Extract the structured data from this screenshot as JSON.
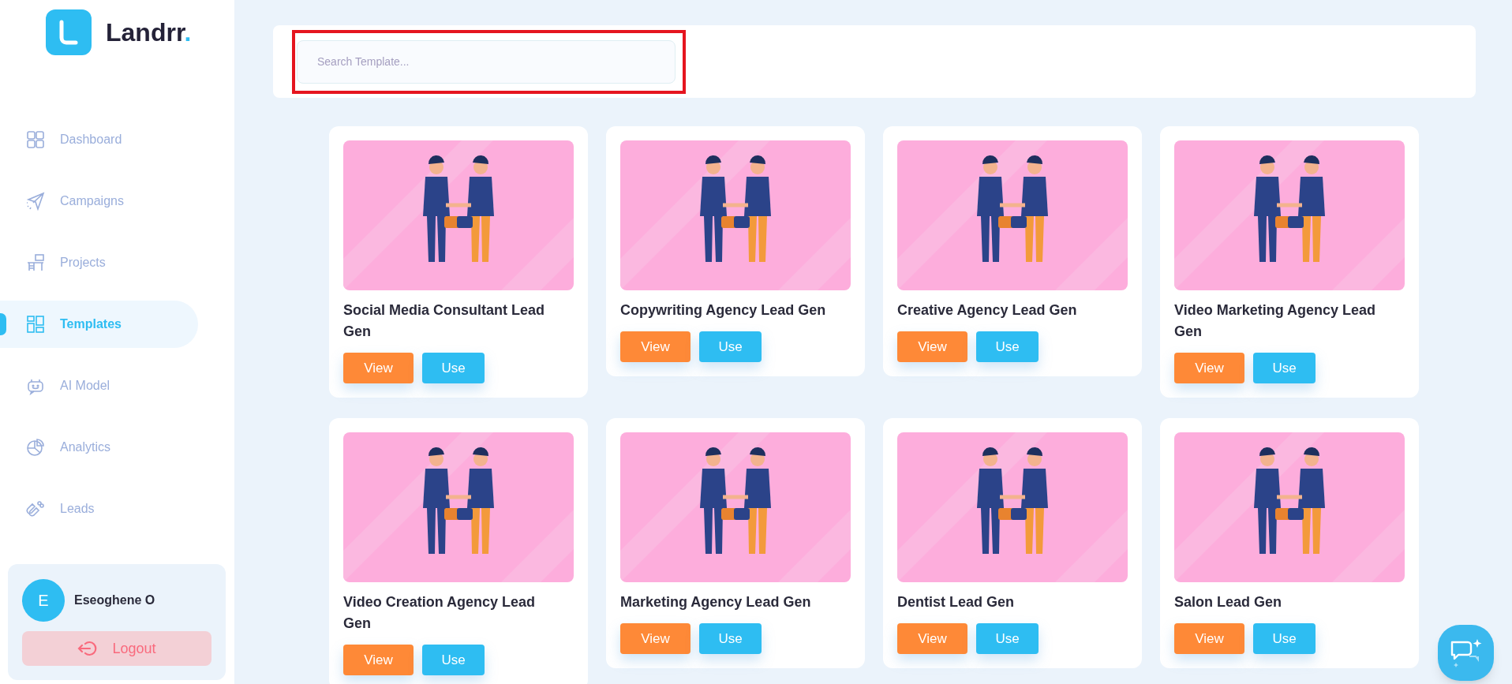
{
  "brand": {
    "name": "Landrr",
    "dot": "."
  },
  "sidebar": {
    "items": [
      {
        "label": "Dashboard",
        "selected": false
      },
      {
        "label": "Campaigns",
        "selected": false
      },
      {
        "label": "Projects",
        "selected": false
      },
      {
        "label": "Templates",
        "selected": true
      },
      {
        "label": "AI Model",
        "selected": false
      },
      {
        "label": "Analytics",
        "selected": false
      },
      {
        "label": "Leads",
        "selected": false
      }
    ]
  },
  "user": {
    "initial": "E",
    "name": "Eseoghene O",
    "logout": "Logout"
  },
  "search": {
    "placeholder": "Search Template...",
    "highlighted": true
  },
  "templates": [
    {
      "title": "Social Media Consultant Lead Gen",
      "view": "View",
      "use": "Use"
    },
    {
      "title": "Copywriting Agency Lead Gen",
      "view": "View",
      "use": "Use"
    },
    {
      "title": "Creative Agency Lead Gen",
      "view": "View",
      "use": "Use"
    },
    {
      "title": "Video Marketing Agency Lead Gen",
      "view": "View",
      "use": "Use"
    },
    {
      "title": "Video Creation Agency Lead Gen",
      "view": "View",
      "use": "Use"
    },
    {
      "title": "Marketing Agency Lead Gen",
      "view": "View",
      "use": "Use"
    },
    {
      "title": "Dentist Lead Gen",
      "view": "View",
      "use": "Use"
    },
    {
      "title": "Salon Lead Gen",
      "view": "View",
      "use": "Use"
    }
  ]
}
